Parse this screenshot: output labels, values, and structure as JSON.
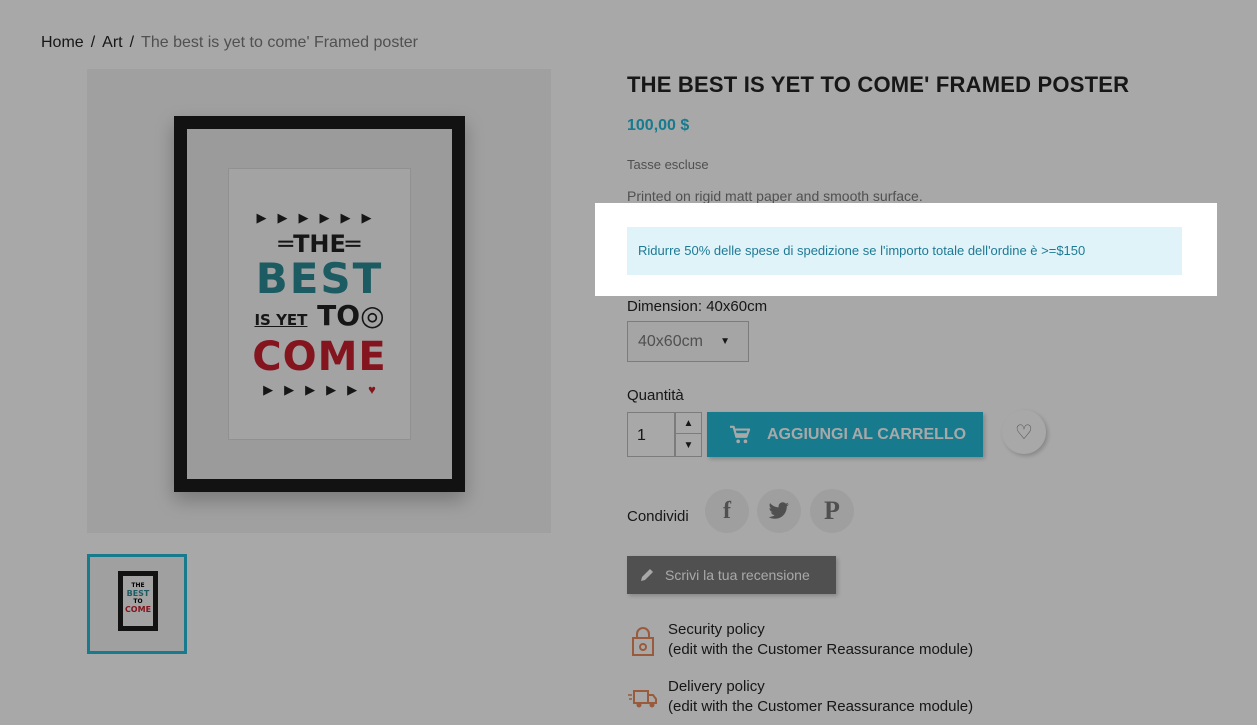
{
  "breadcrumb": {
    "items": [
      "Home",
      "Art",
      "The best is yet to come' Framed poster"
    ],
    "separator": "/"
  },
  "product": {
    "title": "THE BEST IS YET TO COME' FRAMED POSTER",
    "price": "100,00 $",
    "tax_note": "Tasse escluse",
    "description": "Printed on rigid matt paper and smooth surface."
  },
  "poster": {
    "line1": "THE",
    "line2": "BEST",
    "line3a": "IS YET",
    "line3b": "TO",
    "line4": "COME",
    "arrows_top": "▶▶▶▶▶▶",
    "arrows_bottom": "▶▶▶▶▶",
    "heart": "♥"
  },
  "promo": {
    "message": "Ridurre 50% delle spese di spedizione se l'importo totale dell'ordine è >=$150"
  },
  "variant": {
    "label": "Dimension: 40x60cm",
    "selected": "40x60cm",
    "caret": "▼"
  },
  "quantity": {
    "label": "Quantità",
    "value": "1",
    "up": "▲",
    "down": "▼"
  },
  "cart": {
    "add_label": "AGGIUNGI AL CARRELLO"
  },
  "wishlist": {
    "icon": "♡"
  },
  "share": {
    "label": "Condividi",
    "facebook": "f",
    "twitter": "t",
    "pinterest": "P"
  },
  "review": {
    "label": "Scrivi la tua recensione"
  },
  "reassurance": [
    {
      "title": "Security policy",
      "text": "(edit with the Customer Reassurance module)"
    },
    {
      "title": "Delivery policy",
      "text": "(edit with the Customer Reassurance module)"
    }
  ],
  "colors": {
    "accent": "#24b9d7",
    "text_dark": "#232323",
    "text_muted": "#7a7a7a",
    "poster_teal": "#2d8a95",
    "poster_red": "#c9202f",
    "promo_bg": "#e0f3f9",
    "reassurance_icon": "#e98b5a"
  }
}
